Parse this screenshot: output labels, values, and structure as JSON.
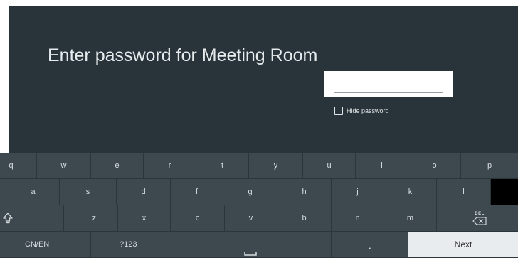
{
  "dialog": {
    "title": "Enter password for Meeting Room",
    "password_value": "",
    "hide_password_label": "Hide password",
    "hide_password_checked": false
  },
  "keyboard": {
    "row1": [
      "q",
      "w",
      "e",
      "r",
      "t",
      "y",
      "u",
      "i",
      "o",
      "p"
    ],
    "row2": [
      "a",
      "s",
      "d",
      "f",
      "g",
      "h",
      "j",
      "k",
      "l"
    ],
    "row3": [
      "z",
      "x",
      "c",
      "v",
      "b",
      "n",
      "m"
    ],
    "shift_icon": "shift-icon",
    "delete_label": "DEL",
    "delete_icon": "backspace-icon",
    "lang_label": "CN/EN",
    "symbols_label": "?123",
    "space_icon": "space-icon",
    "period_label": ".",
    "next_label": "Next"
  },
  "colors": {
    "background": "#29343a",
    "keyboard": "#3e494f",
    "next_key": "#e9ecee",
    "text": "#e6ebee"
  }
}
